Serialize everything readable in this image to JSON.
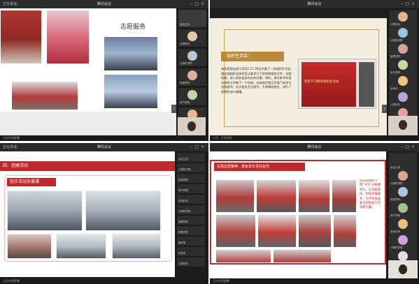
{
  "window_title": "腾讯会议",
  "meeting_label": "正在讲话：",
  "q1": {
    "slide_title": "志愿服务",
    "participants": [
      "会议主持",
      "计算机系",
      "计算机学院",
      "机械学院",
      "电气学院",
      "自动化系",
      "计算机系"
    ],
    "bottom_text": "正在共享屏幕"
  },
  "q2": {
    "banner_title": "组织生活会：",
    "body_text": "本年度我支部于2022.11.28日开展了一次组织生活会，我支部组织全体党员认真学习了党章和相关文件，对照检查，深入剖析自身存在的问题。同时，我对本学年度支部的工作做了一个总结，支部成员相互开展了批评与自我批评，在大家发言过程中，大家畅所欲言，进行了思想交流与碰撞。",
    "screen_title": "党史学习教育组织生活会",
    "participants": [
      "计算机系",
      "计算机学院",
      "管理学院",
      "电气学院",
      "自动化",
      "计算机系",
      "马克思",
      "数学系"
    ],
    "bottom_text": "八月 · 正在讲话"
  },
  "q3": {
    "section_title": "四、团建活动",
    "subtitle": "团日活动及援课",
    "participants": [
      "会议主持",
      "计算机学院",
      "机械学院",
      "电气学院",
      "自动化系",
      "计算机学院",
      "管理学院",
      "物理学院",
      "数学系",
      "化学系",
      "计算机系"
    ],
    "bottom_text": "正在共享屏幕"
  },
  "q4": {
    "heading": "弘扬志愿精神，勇担青年责任担当",
    "side_text": "团支部组织学院“众为”志愿服务队，在战疫期间，积极开展服务，为学校食品安全和防疫工作贡献力量。",
    "participants": [
      "会议主持",
      "计算机学院",
      "机械学院",
      "电气学院",
      "自动化系",
      "计算机学院",
      "管理学院",
      "物理学院"
    ],
    "bottom_text": "正在共享屏幕"
  },
  "colors": {
    "accent_red": "#c0282b",
    "gold": "#b98a3a",
    "dark_bg": "#1e1e1e"
  }
}
